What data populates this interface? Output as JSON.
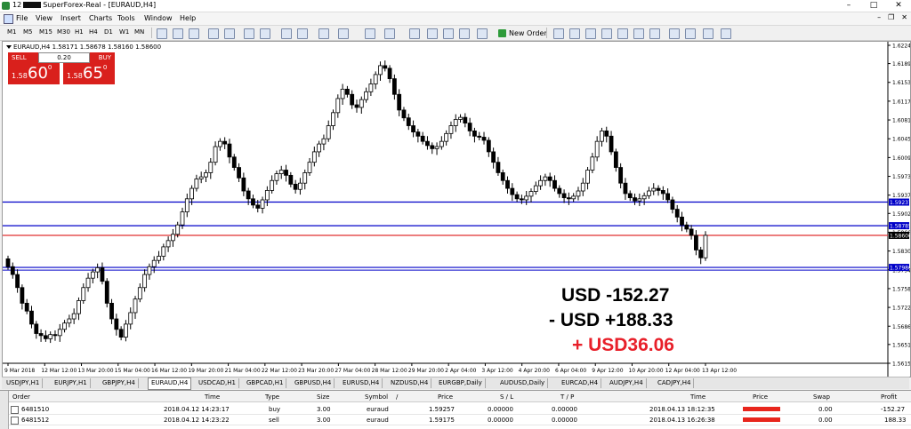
{
  "window": {
    "title_prefix": "12",
    "title_suffix": "SuperForex-Real - [EURAUD,H4]",
    "controls": [
      "–",
      "□",
      "✕"
    ]
  },
  "menu": [
    "File",
    "View",
    "Insert",
    "Charts",
    "Tools",
    "Window",
    "Help"
  ],
  "mdi_controls": [
    "–",
    "❐",
    "✕"
  ],
  "toolbar": {
    "timeframes": [
      "M1",
      "M5",
      "M15",
      "M30",
      "H1",
      "H4",
      "D1",
      "W1",
      "MN"
    ],
    "new_order": "New Order"
  },
  "chart": {
    "symbol_line": "EURAUD,H4  1.58171 1.58678 1.58160 1.58600",
    "sell_label": "SELL",
    "buy_label": "BUY",
    "volume": "0.20",
    "sell_price_small": "1.58",
    "sell_price_big": "60",
    "sell_price_sup": "0",
    "buy_price_small": "1.58",
    "buy_price_big": "65",
    "buy_price_sup": "0",
    "pnl_line1": "USD -152.27",
    "pnl_line2": "- USD +188.33",
    "pnl_line3": "+ USD36.06",
    "pnl_color_total": "#e8202a",
    "line_blue": "#0000c8",
    "line_red": "#e03030"
  },
  "chart_data": {
    "type": "candlestick",
    "symbol": "EURAUD",
    "timeframe": "H4",
    "y_ticks": [
      "1.62240",
      "1.61890",
      "1.61530",
      "1.61170",
      "1.60810",
      "1.60450",
      "1.60090",
      "1.59730",
      "1.59370",
      "1.59020",
      "1.58660",
      "1.58300",
      "1.57940",
      "1.57580",
      "1.57220",
      "1.56860",
      "1.56510",
      "1.56150"
    ],
    "ylim": [
      1.5615,
      1.6224
    ],
    "x_ticks": [
      "9 Mar 2018",
      "12 Mar 12:00",
      "13 Mar 20:00",
      "15 Mar 04:00",
      "16 Mar 12:00",
      "19 Mar 20:00",
      "21 Mar 04:00",
      "22 Mar 12:00",
      "23 Mar 20:00",
      "27 Mar 04:00",
      "28 Mar 12:00",
      "29 Mar 20:00",
      "2 Apr 04:00",
      "3 Apr 12:00",
      "4 Apr 20:00",
      "6 Apr 04:00",
      "9 Apr 12:00",
      "10 Apr 20:00",
      "12 Apr 04:00",
      "13 Apr 12:00"
    ],
    "horizontal_lines": [
      {
        "price": 1.59237,
        "label": "1.59237",
        "color": "#0000c8"
      },
      {
        "price": 1.58785,
        "label": "1.58785",
        "color": "#0000c8"
      },
      {
        "price": 1.586,
        "label": "1.58600",
        "color": "#e03030"
      },
      {
        "price": 1.57986,
        "label": "1.57986",
        "color": "#0000c8"
      }
    ],
    "closes": [
      1.58,
      1.5785,
      1.576,
      1.573,
      1.5715,
      1.569,
      1.5672,
      1.5668,
      1.5662,
      1.567,
      1.5668,
      1.568,
      1.5692,
      1.57,
      1.571,
      1.5735,
      1.576,
      1.5778,
      1.579,
      1.5798,
      1.5772,
      1.573,
      1.57,
      1.568,
      1.5665,
      1.569,
      1.5712,
      1.5738,
      1.576,
      1.5785,
      1.58,
      1.5812,
      1.582,
      1.5838,
      1.585,
      1.5862,
      1.588,
      1.5905,
      1.593,
      1.595,
      1.5968,
      1.5972,
      1.598,
      1.6,
      1.603,
      1.604,
      1.6035,
      1.601,
      1.599,
      1.597,
      1.5945,
      1.593,
      1.5918,
      1.5912,
      1.5928,
      1.5946,
      1.5965,
      1.5978,
      1.5985,
      1.5975,
      1.5958,
      1.5948,
      1.596,
      1.598,
      1.6,
      1.602,
      1.6035,
      1.6045,
      1.607,
      1.6095,
      1.6122,
      1.614,
      1.613,
      1.611,
      1.6105,
      1.612,
      1.6135,
      1.615,
      1.6168,
      1.6185,
      1.618,
      1.616,
      1.613,
      1.61,
      1.6085,
      1.607,
      1.6058,
      1.605,
      1.604,
      1.6032,
      1.6026,
      1.603,
      1.604,
      1.6055,
      1.607,
      1.6082,
      1.6086,
      1.6075,
      1.606,
      1.605,
      1.6048,
      1.6042,
      1.602,
      1.6,
      1.598,
      1.5965,
      1.595,
      1.5938,
      1.593,
      1.5928,
      1.5935,
      1.5944,
      1.5955,
      1.5965,
      1.5972,
      1.5965,
      1.595,
      1.594,
      1.5932,
      1.593,
      1.5935,
      1.5945,
      1.596,
      1.5985,
      1.601,
      1.604,
      1.606,
      1.605,
      1.602,
      1.599,
      1.596,
      1.594,
      1.5932,
      1.5926,
      1.593,
      1.5936,
      1.5945,
      1.595,
      1.5946,
      1.594,
      1.5928,
      1.591,
      1.5895,
      1.588,
      1.5872,
      1.586,
      1.5832,
      1.5817,
      1.586
    ],
    "title": "",
    "xlabel": "",
    "ylabel": ""
  },
  "symbol_tabs": [
    "USDJPY,H1",
    "EURJPY,H1",
    "GBPJPY,H4",
    "EURAUD,H4",
    "USDCAD,H1",
    "GBPCAD,H1",
    "GBPUSD,H4",
    "EURUSD,H4",
    "NZDUSD,H4",
    "EURGBP,Daily",
    "AUDUSD,Daily",
    "EURCAD,H4",
    "AUDJPY,H4",
    "CADJPY,H4"
  ],
  "active_tab": "EURAUD,H4",
  "terminal": {
    "headers": [
      "Order",
      "Time",
      "Type",
      "Size",
      "Symbol",
      "/",
      "Price",
      "S / L",
      "T / P",
      "Time",
      "Price",
      "Swap",
      "Profit"
    ],
    "rows": [
      {
        "order": "6481510",
        "time": "2018.04.12 14:23:17",
        "type": "buy",
        "size": "3.00",
        "symbol": "euraud",
        "price": "1.59257",
        "sl": "0.00000",
        "tp": "0.00000",
        "close_time": "2018.04.13 18:12:35",
        "swap": "0.00",
        "profit": "-152.27"
      },
      {
        "order": "6481512",
        "time": "2018.04.12 14:23:22",
        "type": "sell",
        "size": "3.00",
        "symbol": "euraud",
        "price": "1.59175",
        "sl": "0.00000",
        "tp": "0.00000",
        "close_time": "2018.04.13 16:26:38",
        "swap": "0.00",
        "profit": "188.33"
      }
    ]
  }
}
